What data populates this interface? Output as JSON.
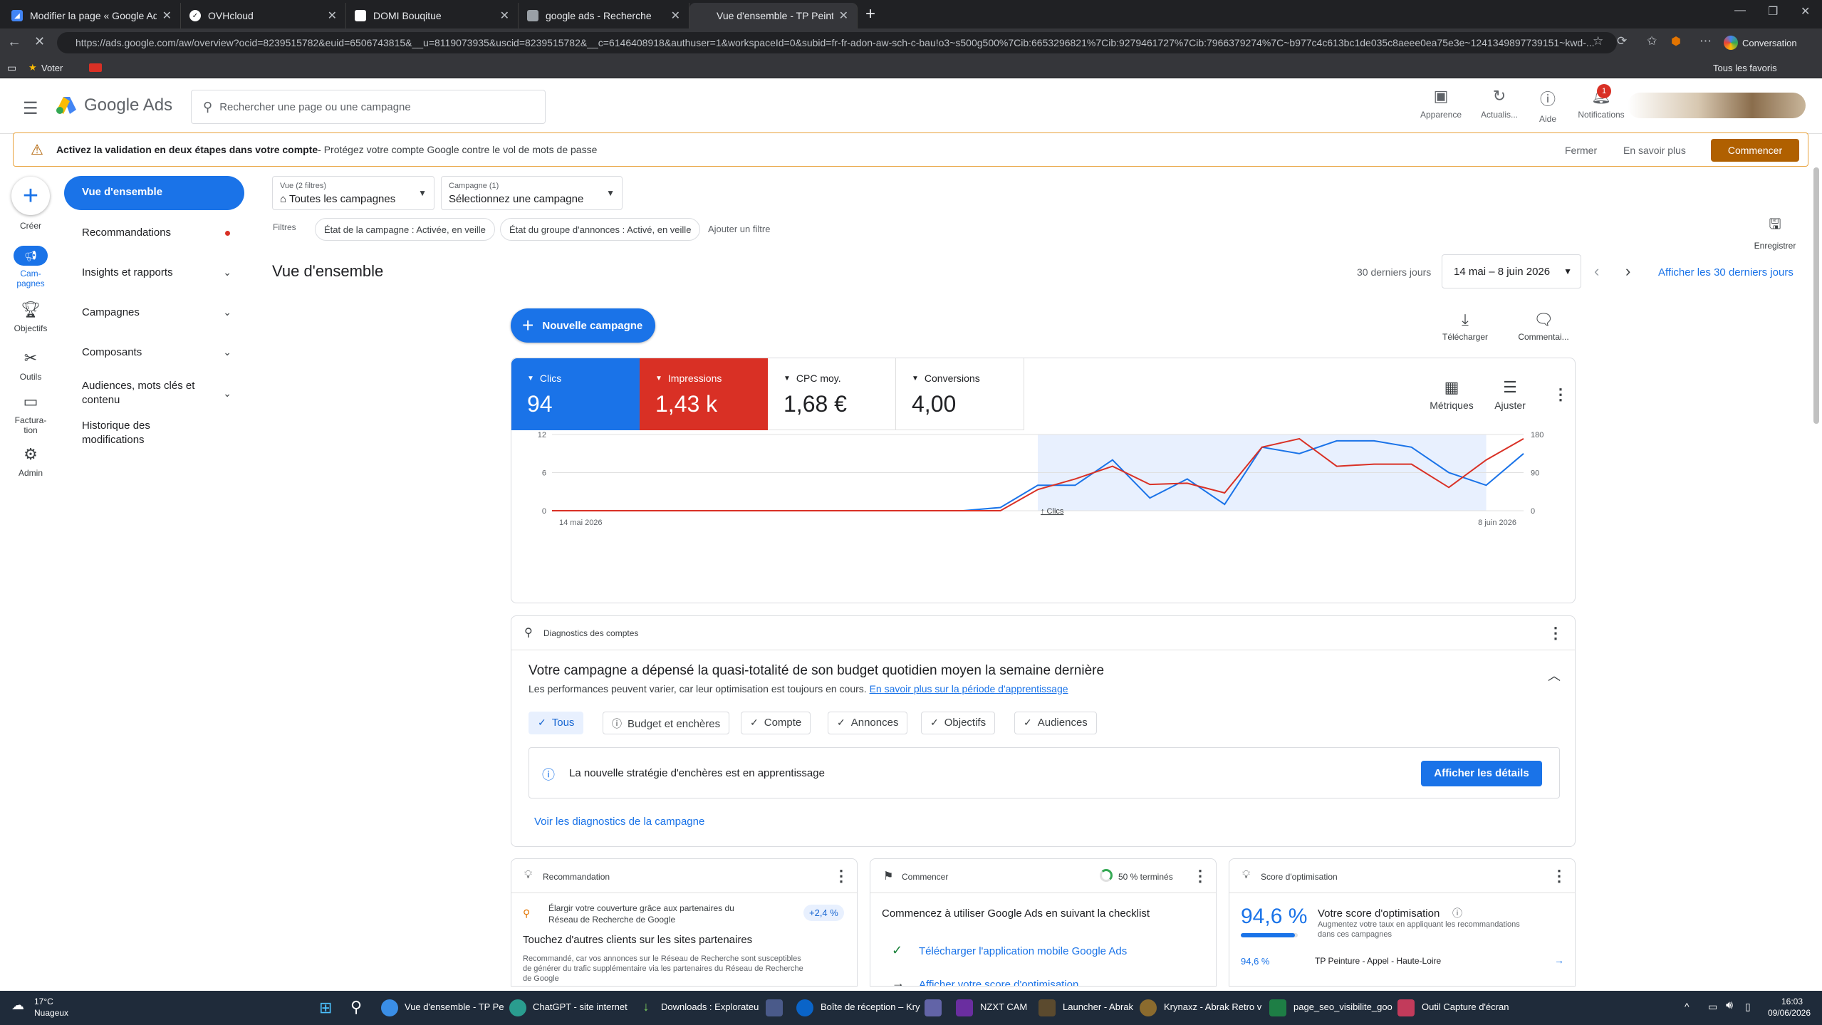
{
  "browser": {
    "tabs": [
      {
        "title": "Modifier la page « Google Ads » ‹",
        "favicon_color": "#4285f4",
        "active": false
      },
      {
        "title": "OVHcloud",
        "favicon_color": "#ffffff",
        "active": false
      },
      {
        "title": "DOMI Bouqitue",
        "favicon_color": "#ffffff",
        "active": false
      },
      {
        "title": "google ads - Recherche",
        "favicon_color": "#9aa0a6",
        "active": false
      },
      {
        "title": "Vue d'ensemble - TP Peinture Hau",
        "favicon_color": "#1a73e8",
        "active": true
      }
    ],
    "url": "https://ads.google.com/aw/overview?ocid=8239515782&euid=6506743815&__u=8119073935&uscid=8239515782&__c=6146408918&authuser=1&workspaceId=0&subid=fr-fr-adon-aw-sch-c-bau!o3~s500g500%7Cib:6653296821%7Cib:9279461727%7Cib:7966379274%7C~b977c4c613bc1de035c8aeee0ea75e3e~1241349897739151~kwd-...",
    "conversation_label": "Conversation",
    "bookmark_label": "Voter",
    "other_bookmarks": "Tous les favoris"
  },
  "header": {
    "app_name": "Google Ads",
    "search_placeholder": "Rechercher une page ou une campagne",
    "buttons": [
      "Apparence",
      "Actualis...",
      "Aide",
      "Notifications"
    ],
    "notification_count": "1"
  },
  "alert": {
    "bold": "Activez la validation en deux étapes dans votre compte",
    "text": " - Protégez votre compte Google contre le vol de mots de passe",
    "close": "Fermer",
    "learn_more": "En savoir plus",
    "start": "Commencer"
  },
  "rail": {
    "create": "Créer",
    "campaigns_line1": "Cam-",
    "campaigns_line2": "pagnes",
    "goals": "Objectifs",
    "tools": "Outils",
    "billing_line1": "Factura-",
    "billing_line2": "tion",
    "admin": "Admin"
  },
  "nav": {
    "overview": "Vue d'ensemble",
    "recommendations": "Recommandations",
    "insights": "Insights et rapports",
    "campaigns": "Campagnes",
    "assets": "Composants",
    "audiences_line1": "Audiences, mots clés et",
    "audiences_line2": "contenu",
    "history_line1": "Historique des",
    "history_line2": "modifications"
  },
  "filters": {
    "view_label": "Vue (2 filtres)",
    "view_value": "Toutes les campagnes",
    "campaign_label": "Campagne (1)",
    "campaign_value": "Sélectionnez une campagne",
    "filters_label": "Filtres",
    "chip1": "État de la campagne : Activée, en veille",
    "chip2": "État du groupe d'annonces : Activé, en veille",
    "add_filter": "Ajouter un filtre",
    "save": "Enregistrer"
  },
  "overview": {
    "title": "Vue d'ensemble",
    "last_days": "30 derniers jours",
    "date_range": "14 mai – 8 juin 2026",
    "show_last": "Afficher les 30 derniers jours",
    "new_campaign": "Nouvelle campagne",
    "download": "Télécharger",
    "comment": "Commentai..."
  },
  "metrics": {
    "clics_label": "Clics",
    "clics_value": "94",
    "impr_label": "Impressions",
    "impr_value": "1,43 k",
    "cpc_label": "CPC moy.",
    "cpc_value": "1,68 €",
    "conv_label": "Conversions",
    "conv_value": "4,00",
    "metrics_btn": "Métriques",
    "adjust_btn": "Ajuster",
    "clics_color": "#1a73e8",
    "impr_color": "#d93025"
  },
  "chart_data": {
    "type": "line",
    "x_start_label": "14 mai 2026",
    "x_end_label": "8 juin 2026",
    "left_ticks": [
      "0",
      "6",
      "12"
    ],
    "right_ticks": [
      "0",
      "90",
      "180"
    ],
    "ylim_left": [
      0,
      12
    ],
    "ylim_right": [
      0,
      180
    ],
    "annotation": "Clics",
    "series": [
      {
        "color": "#1a73e8",
        "axis": "left",
        "values": [
          0,
          0,
          0,
          0,
          0,
          0,
          0,
          0,
          0,
          0,
          0,
          0,
          0.5,
          4,
          4,
          8,
          2,
          5,
          1,
          10,
          9,
          11,
          11,
          10,
          6,
          4,
          9
        ]
      },
      {
        "color": "#d93025",
        "axis": "right",
        "values": [
          0,
          0,
          0,
          0,
          0,
          0,
          0,
          0,
          0,
          0,
          0,
          0,
          0,
          50,
          75,
          105,
          62,
          65,
          42,
          150,
          170,
          105,
          110,
          110,
          55,
          120,
          170
        ]
      }
    ]
  },
  "diagnostics": {
    "header": "Diagnostics des comptes",
    "title": "Votre campagne a dépensé la quasi-totalité de son budget quotidien moyen la semaine dernière",
    "subtitle": "Les performances peuvent varier, car leur optimisation est toujours en cours. ",
    "subtitle_link": "En savoir plus sur la période d'apprentissage",
    "chips": [
      "Tous",
      "Budget et enchères",
      "Compte",
      "Annonces",
      "Objectifs",
      "Audiences"
    ],
    "info": "La nouvelle stratégie d'enchères est en apprentissage",
    "details": "Afficher les détails",
    "view_campaign_diag": "Voir les diagnostics de la campagne"
  },
  "cards": {
    "reco_header": "Recommandation",
    "reco_item_line1": "Élargir votre couverture grâce aux partenaires du",
    "reco_item_line2": "Réseau de Recherche de Google",
    "reco_pct": "+2,4 %",
    "reco_title": "Touchez d'autres clients sur les sites partenaires",
    "reco_text_line1": "Recommandé, car vos annonces sur le Réseau de Recherche sont susceptibles",
    "reco_text_line2": "de générer du trafic supplémentaire via les partenaires du Réseau de Recherche",
    "reco_text_line3": "de Google",
    "start_header": "Commencer",
    "start_progress": "50 % terminés",
    "start_title": "Commencez à utiliser Google Ads en suivant la checklist",
    "start_item": "Télécharger l'application mobile Google Ads",
    "start_item2": "Afficher votre score d'optimisation",
    "score_header": "Score d'optimisation",
    "score_value": "94,6 %",
    "score_title": "Votre score d'optimisation",
    "score_text_line1": "Augmentez votre taux en appliquant les recommandations",
    "score_text_line2": "dans ces campagnes",
    "score_row_value": "94,6 %",
    "score_row_name": "TP Peinture - Appel - Haute-Loire",
    "score_fraction": 0.946
  },
  "taskbar": {
    "temp": "17°C",
    "weather": "Nuageux",
    "apps": [
      "Vue d'ensemble - TP Pe",
      "ChatGPT - site internet",
      "Downloads : Explorateu",
      "Boîte de réception – Kry",
      "NZXT CAM",
      "Launcher - Abrak",
      "Krynaxz - Abrak Retro v",
      "page_seo_visibilite_goo",
      "Outil Capture d'écran"
    ],
    "time": "16:03",
    "date": "09/06/2026"
  }
}
